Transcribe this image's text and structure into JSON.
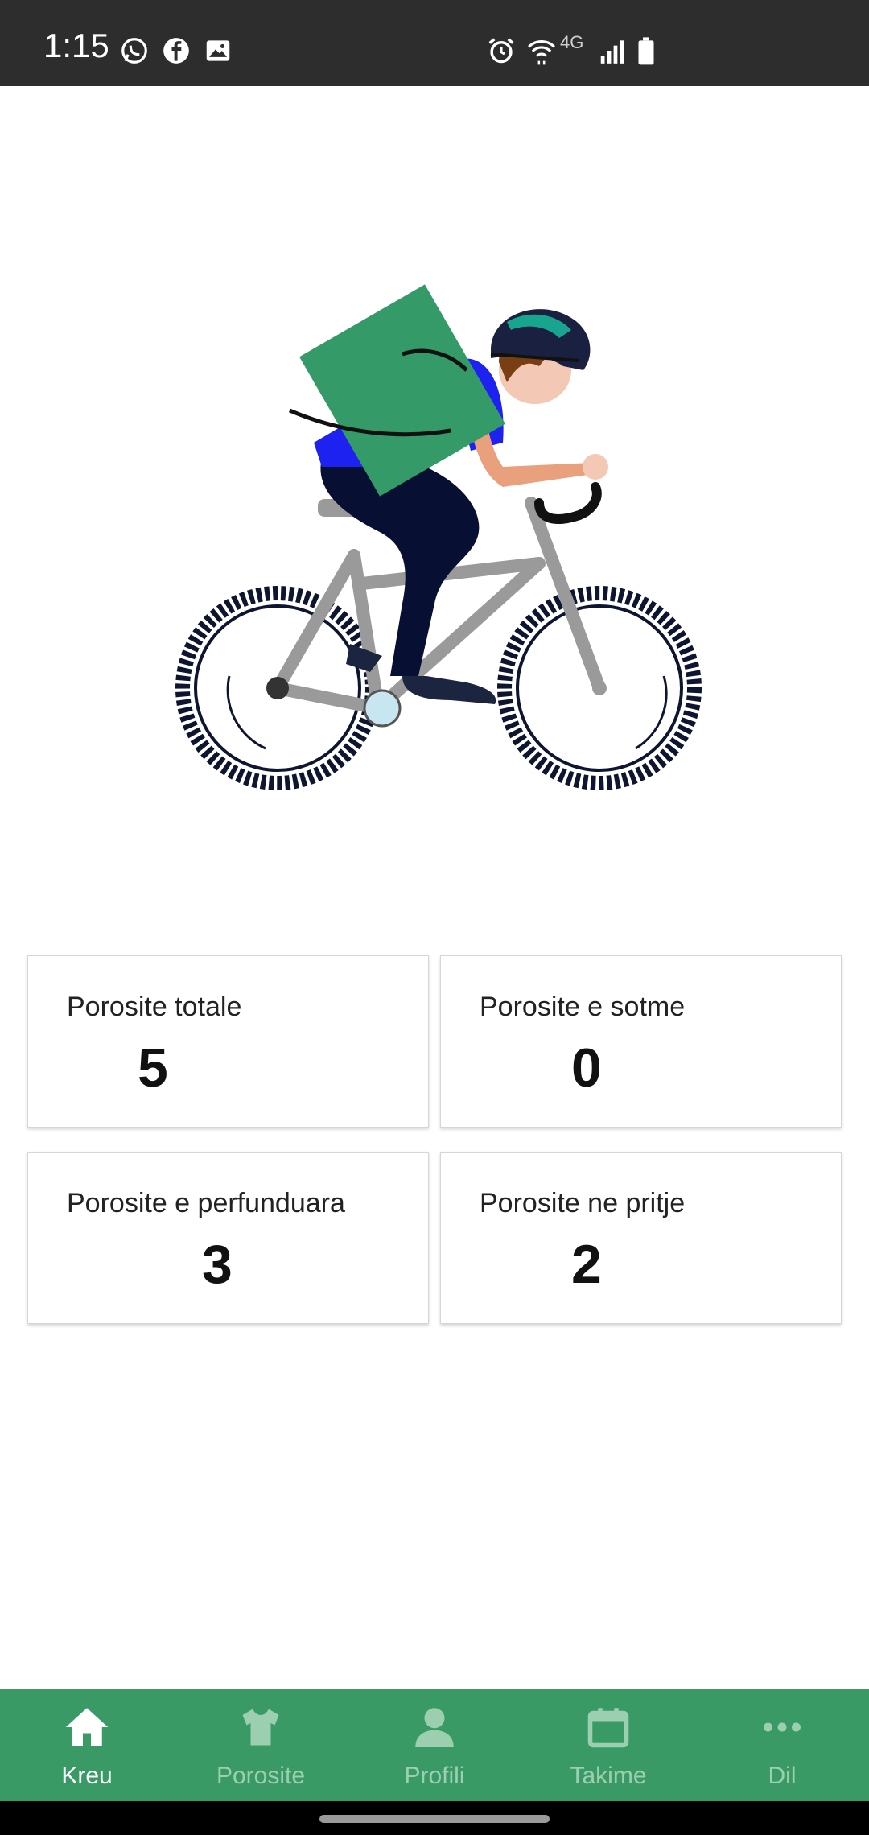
{
  "status_bar": {
    "time": "1:15",
    "left_icons": [
      "whatsapp-icon",
      "facebook-icon",
      "gallery-icon"
    ],
    "right_icons": [
      "alarm-icon",
      "wifi-icon",
      "4g-icon",
      "signal-icon",
      "battery-icon"
    ],
    "network": "4G"
  },
  "stats": {
    "total": {
      "label": "Porosite totale",
      "value": "5"
    },
    "today": {
      "label": "Porosite e sotme",
      "value": "0"
    },
    "completed": {
      "label": "Porosite e perfunduara",
      "value": "3"
    },
    "pending": {
      "label": "Porosite ne pritje",
      "value": "2"
    }
  },
  "bottom_nav": {
    "items": [
      {
        "label": "Kreu",
        "icon": "home-icon",
        "active": true
      },
      {
        "label": "Porosite",
        "icon": "tshirt-icon",
        "active": false
      },
      {
        "label": "Profili",
        "icon": "person-icon",
        "active": false
      },
      {
        "label": "Takime",
        "icon": "calendar-icon",
        "active": false
      },
      {
        "label": "Dil",
        "icon": "more-icon",
        "active": false
      }
    ]
  },
  "colors": {
    "accent": "#3a9a66",
    "nav_active_text": "#ffffff",
    "nav_inactive_text": "#9bcfb0",
    "status_bar": "#2d2d2d"
  }
}
